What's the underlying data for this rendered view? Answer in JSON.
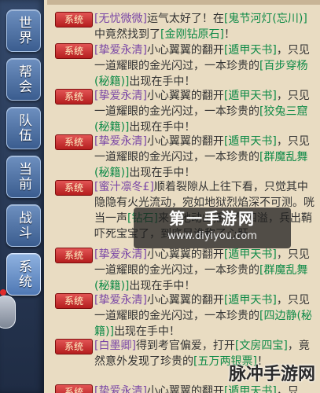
{
  "sidebar": {
    "tabs": [
      {
        "label": "世界",
        "active": false
      },
      {
        "label": "帮会",
        "active": false
      },
      {
        "label": "队伍",
        "active": false
      },
      {
        "label": "当前",
        "active": false
      },
      {
        "label": "战斗",
        "active": false
      },
      {
        "label": "系统",
        "active": true
      }
    ]
  },
  "chat": {
    "tag_label": "系统",
    "messages": [
      {
        "parts": [
          {
            "c": "name",
            "t": "[无忧微微]"
          },
          {
            "c": "plain",
            "t": "运气太好了！在"
          },
          {
            "c": "item",
            "t": "[鬼节河灯(忘川)]"
          },
          {
            "c": "plain",
            "t": "中竟然找到了"
          },
          {
            "c": "item",
            "t": "[金刚钻原石]"
          },
          {
            "c": "plain",
            "t": "！"
          }
        ]
      },
      {
        "parts": [
          {
            "c": "name",
            "t": "[挚爱永清]"
          },
          {
            "c": "plain",
            "t": "小心翼翼的翻开"
          },
          {
            "c": "item",
            "t": "[遁甲天书]"
          },
          {
            "c": "plain",
            "t": "，只见一道耀眼的金光闪过，一本珍贵的"
          },
          {
            "c": "item",
            "t": "[百步穿杨(秘籍)]"
          },
          {
            "c": "plain",
            "t": "出现在手中！"
          }
        ]
      },
      {
        "parts": [
          {
            "c": "name",
            "t": "[挚爱永清]"
          },
          {
            "c": "plain",
            "t": "小心翼翼的翻开"
          },
          {
            "c": "item",
            "t": "[遁甲天书]"
          },
          {
            "c": "plain",
            "t": "，只见一道耀眼的金光闪过，一本珍贵的"
          },
          {
            "c": "item",
            "t": "[狡兔三窟(秘籍)]"
          },
          {
            "c": "plain",
            "t": "出现在手中！"
          }
        ]
      },
      {
        "parts": [
          {
            "c": "name",
            "t": "[挚爱永清]"
          },
          {
            "c": "plain",
            "t": "小心翼翼的翻开"
          },
          {
            "c": "item",
            "t": "[遁甲天书]"
          },
          {
            "c": "plain",
            "t": "，只见一道耀眼的金光闪过，一本珍贵的"
          },
          {
            "c": "item",
            "t": "[群魔乱舞(秘籍)]"
          },
          {
            "c": "plain",
            "t": "出现在手中！"
          }
        ]
      },
      {
        "parts": [
          {
            "c": "name",
            "t": "[蜜汁凛冬£]"
          },
          {
            "c": "plain",
            "t": "顺着裂隙从上往下看，只觉其中隐隐有火光流动，宛如地狱烈焰深不可测。咣当一声"
          },
          {
            "c": "item",
            "t": "[钻石]"
          },
          {
            "c": "plain",
            "t": "来，地动山摇杀气四溢，"
          },
          {
            "c": "plain",
            "t": "兵出鞘吓死宝宝了，到底是谁称了心肝"
          }
        ]
      },
      {
        "parts": [
          {
            "c": "name",
            "t": "[挚爱永清]"
          },
          {
            "c": "plain",
            "t": "小心翼翼的翻开"
          },
          {
            "c": "item",
            "t": "[遁甲天书]"
          },
          {
            "c": "plain",
            "t": "，只见一道耀眼的金光闪过，一本珍贵的"
          },
          {
            "c": "item",
            "t": "[群魔乱舞(秘籍)]"
          },
          {
            "c": "plain",
            "t": "出现在手中！"
          }
        ]
      },
      {
        "parts": [
          {
            "c": "name",
            "t": "[挚爱永清]"
          },
          {
            "c": "plain",
            "t": "小心翼翼的翻开"
          },
          {
            "c": "item",
            "t": "[遁甲天书]"
          },
          {
            "c": "plain",
            "t": "，只见一道耀眼的金光闪过，一本珍贵的"
          },
          {
            "c": "item",
            "t": "[四边静(秘籍)]"
          },
          {
            "c": "plain",
            "t": "出现在手中！"
          }
        ]
      },
      {
        "parts": [
          {
            "c": "name",
            "t": "[白墨卿]"
          },
          {
            "c": "plain",
            "t": "得到考官偏爱，打开"
          },
          {
            "c": "item",
            "t": "[文房四宝]"
          },
          {
            "c": "plain",
            "t": "，竟然意外发现了珍贵的"
          },
          {
            "c": "item",
            "t": "[五万两银票]"
          },
          {
            "c": "plain",
            "t": "！"
          }
        ]
      },
      {
        "parts": [
          {
            "c": "name",
            "t": "[挚爱永清]"
          },
          {
            "c": "plain",
            "t": "小心翼翼的翻开"
          },
          {
            "c": "item",
            "t": "[遁甲天书]"
          },
          {
            "c": "plain",
            "t": "，只"
          }
        ]
      }
    ]
  },
  "watermark": {
    "logo": "第一手游网",
    "url": "www.diyiyou.com"
  },
  "corner_watermark": "脉冲手游网"
}
